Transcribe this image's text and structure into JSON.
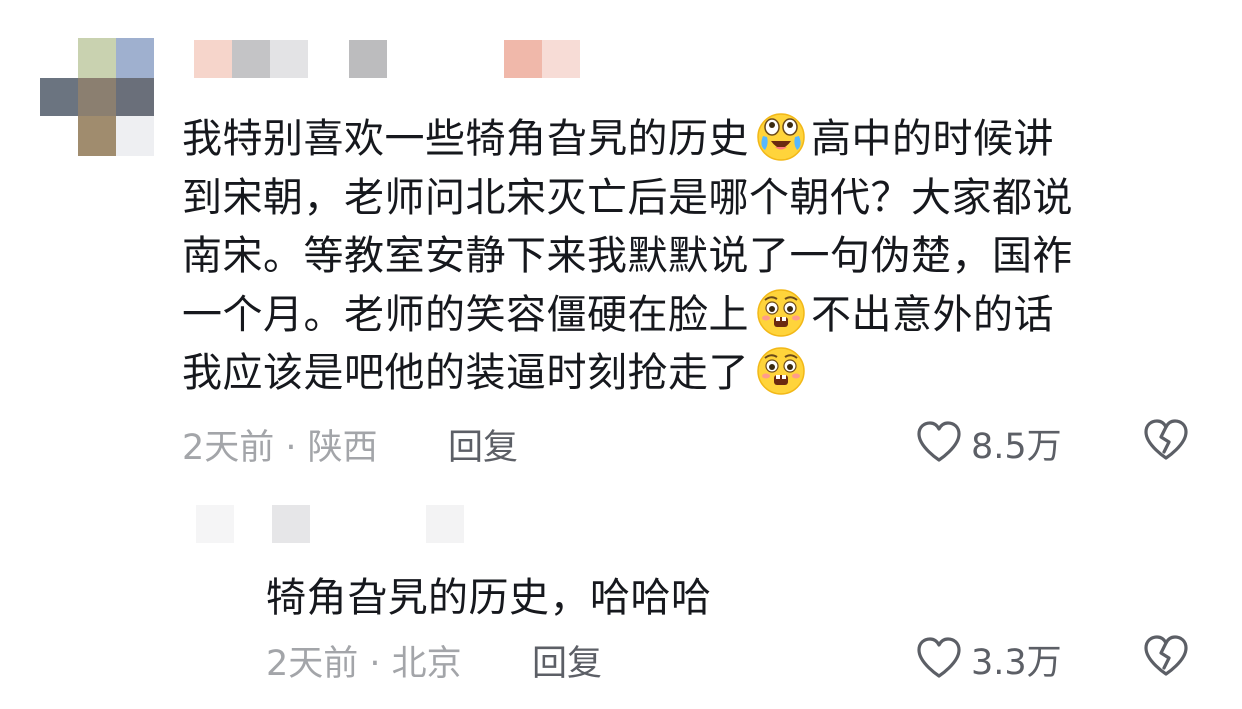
{
  "comment": {
    "lines": [
      [
        "我特别喜欢一些犄角旮旯的历史",
        "高中的时候讲"
      ],
      [
        "到宋朝，老师问北宋灭亡后是哪个朝代？大家都说"
      ],
      [
        "南宋。等教室安静下来我默默说了一句伪楚，国祚"
      ],
      [
        "一个月。老师的笑容僵硬在脸上",
        "不出意外的话"
      ],
      [
        "我应该是吧他的装逼时刻抢走了"
      ]
    ],
    "emojis": [
      "laughing-tears-emoji",
      "pleading-emoji",
      "pleading-emoji"
    ],
    "time_location": "2天前 · 陕西",
    "reply_label": "回复",
    "likes": "8.5万"
  },
  "reply": {
    "text": "犄角旮旯的历史，哈哈哈",
    "time_location": "2天前 · 北京",
    "reply_label": "回复",
    "likes": "3.3万"
  },
  "icons": {
    "like": "heart-outline-icon",
    "dislike": "broken-heart-icon"
  },
  "colors": {
    "text": "#16181d",
    "meta": "#a3a5a9",
    "action": "#5c5f66",
    "icon": "#5c5f66"
  }
}
